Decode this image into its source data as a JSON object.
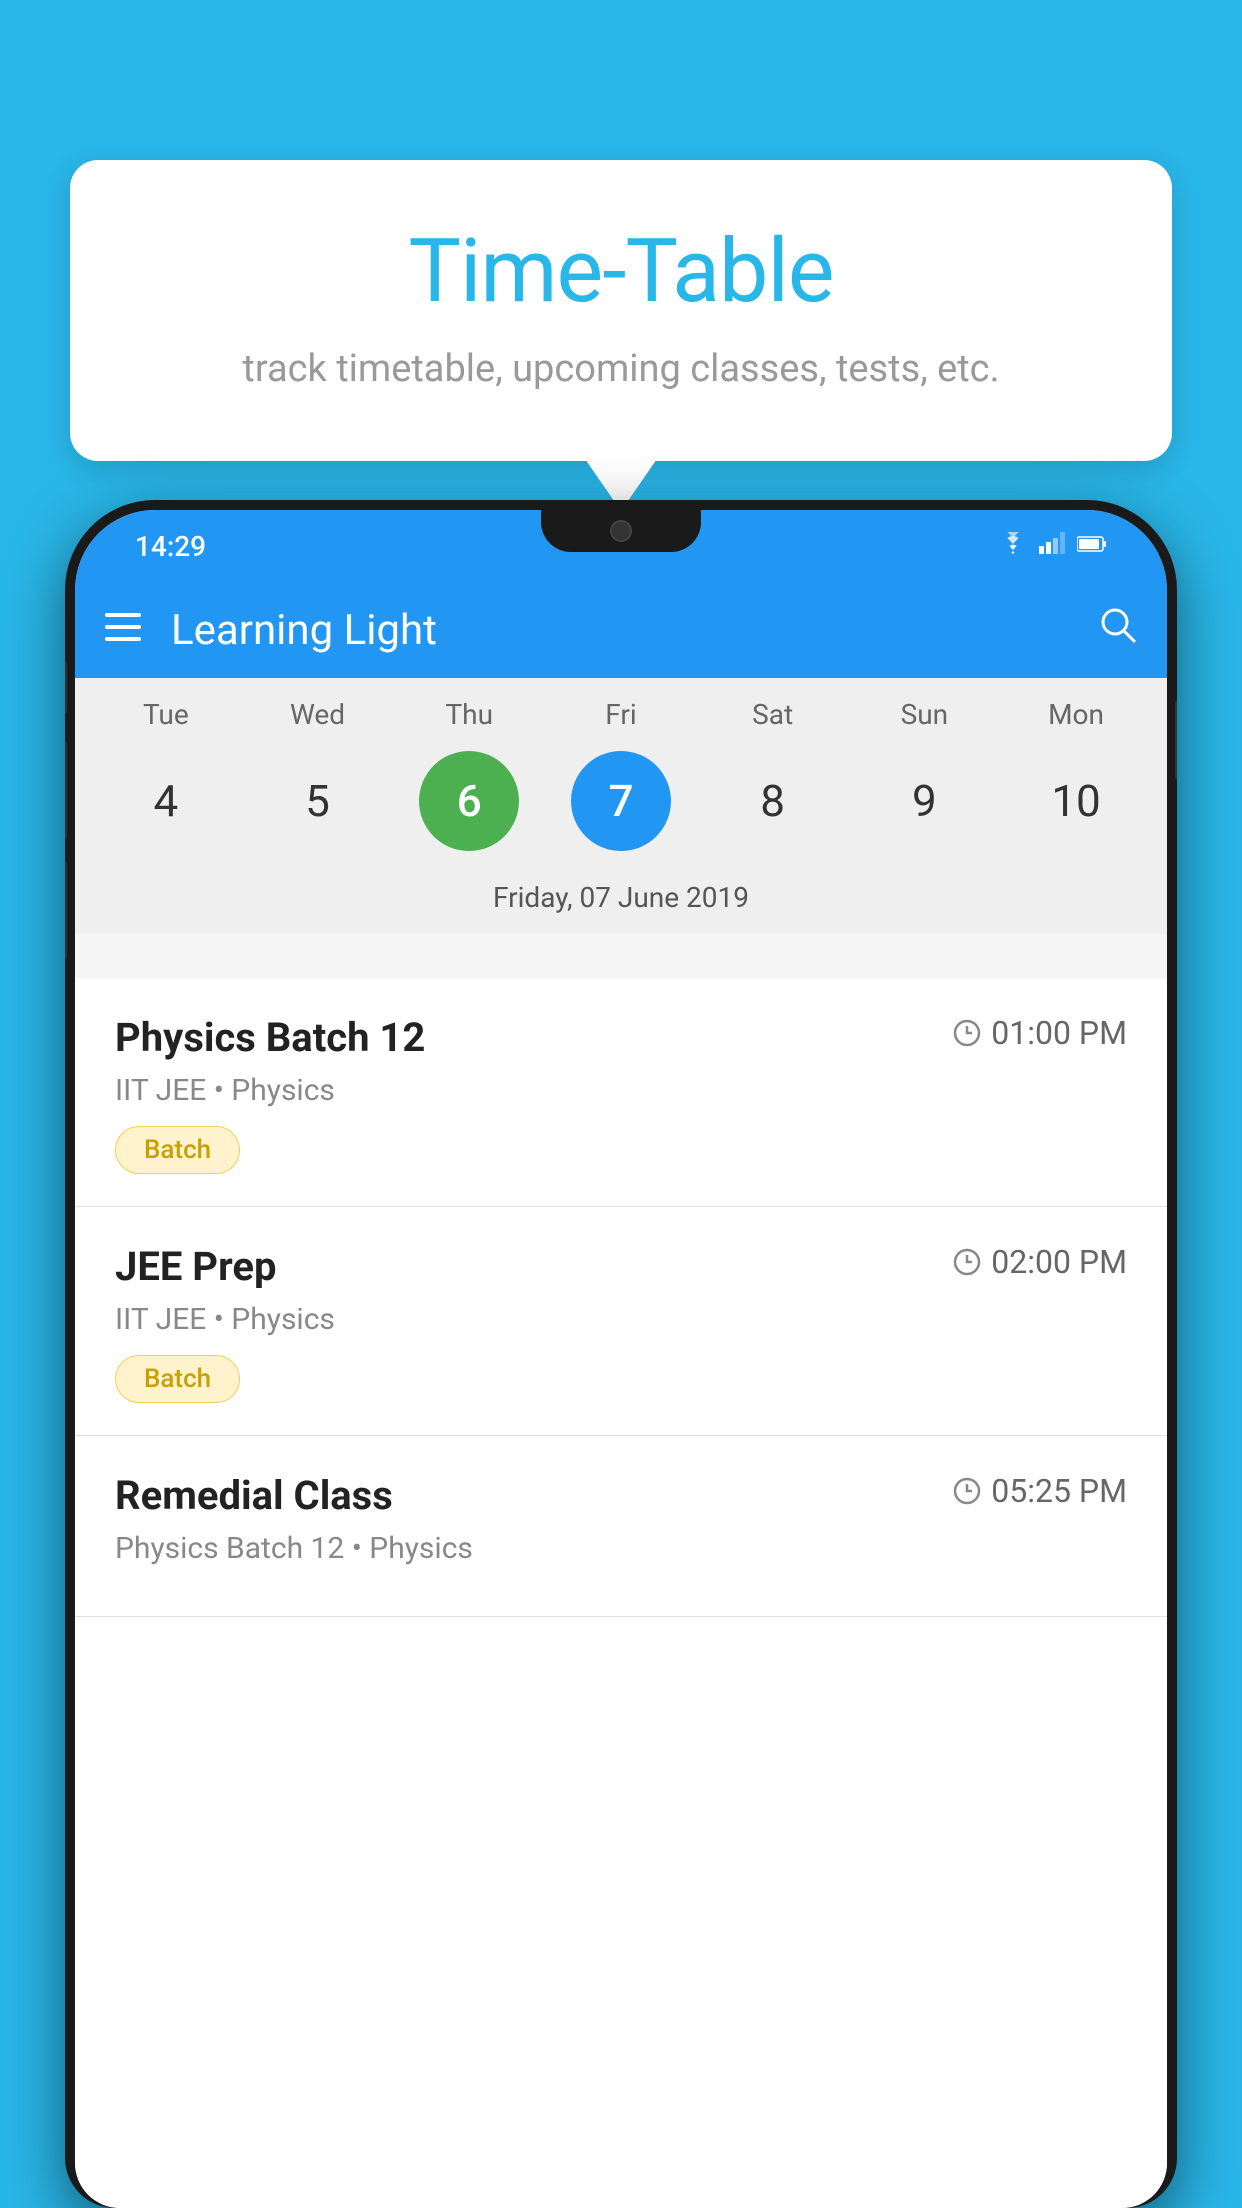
{
  "background_color": "#29b6e8",
  "tooltip": {
    "title": "Time-Table",
    "subtitle": "track timetable, upcoming classes, tests, etc."
  },
  "phone": {
    "status_bar": {
      "time": "14:29",
      "wifi": "▾",
      "signal": "▾",
      "battery": "▮"
    },
    "app_bar": {
      "title": "Learning Light",
      "hamburger_label": "☰",
      "search_label": "🔍"
    },
    "calendar": {
      "days": [
        {
          "label": "Tue",
          "num": "4"
        },
        {
          "label": "Wed",
          "num": "5"
        },
        {
          "label": "Thu",
          "num": "6",
          "state": "today"
        },
        {
          "label": "Fri",
          "num": "7",
          "state": "selected"
        },
        {
          "label": "Sat",
          "num": "8"
        },
        {
          "label": "Sun",
          "num": "9"
        },
        {
          "label": "Mon",
          "num": "10"
        }
      ],
      "selected_date_label": "Friday, 07 June 2019"
    },
    "schedule": [
      {
        "title": "Physics Batch 12",
        "time": "01:00 PM",
        "subtitle": "IIT JEE • Physics",
        "tag": "Batch"
      },
      {
        "title": "JEE Prep",
        "time": "02:00 PM",
        "subtitle": "IIT JEE • Physics",
        "tag": "Batch"
      },
      {
        "title": "Remedial Class",
        "time": "05:25 PM",
        "subtitle": "Physics Batch 12 • Physics",
        "tag": ""
      }
    ]
  }
}
